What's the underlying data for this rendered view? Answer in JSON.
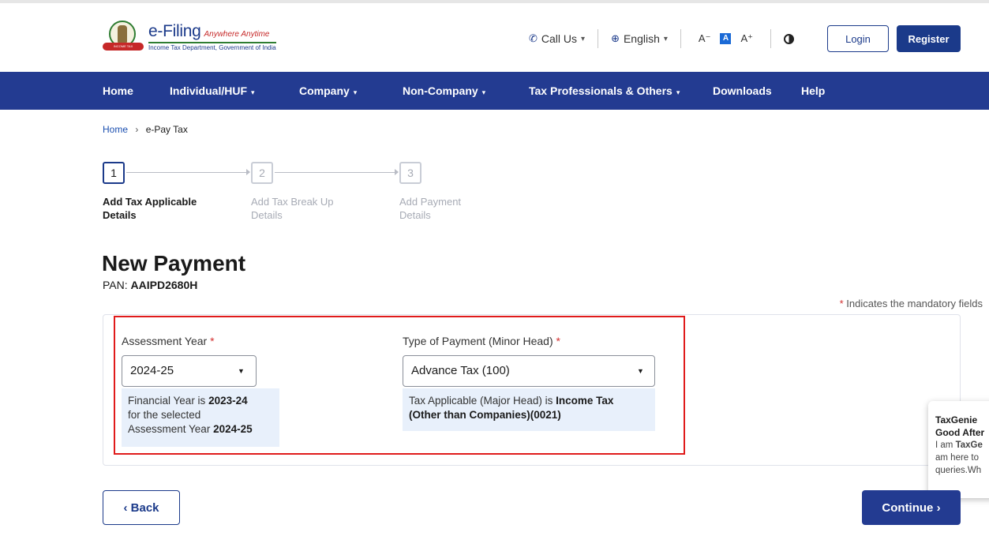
{
  "header": {
    "brand_name": "e-Filing",
    "brand_tagline": "Anywhere Anytime",
    "brand_subtitle": "Income Tax Department, Government of India",
    "emblem_ribbon_text": "INCOME TAX DEPARTMENT",
    "call_us": "Call Us",
    "language": "English",
    "font_decrease": "A⁻",
    "font_normal": "A",
    "font_increase": "A⁺",
    "login": "Login",
    "register": "Register",
    "accent_color": "#1b3a8a"
  },
  "nav": {
    "items": [
      {
        "label": "Home"
      },
      {
        "label": "Individual/HUF"
      },
      {
        "label": "Company"
      },
      {
        "label": "Non-Company"
      },
      {
        "label": "Tax Professionals & Others"
      },
      {
        "label": "Downloads"
      },
      {
        "label": "Help"
      }
    ],
    "background_color": "#233b91"
  },
  "breadcrumb": {
    "home": "Home",
    "current": "e-Pay Tax"
  },
  "stepper": {
    "steps": [
      {
        "number": "1",
        "line1": "Add Tax Applicable",
        "line2": "Details",
        "state": "active"
      },
      {
        "number": "2",
        "line1": "Add Tax Break Up",
        "line2": "Details",
        "state": "inactive"
      },
      {
        "number": "3",
        "line1": "Add Payment",
        "line2": "Details",
        "state": "inactive"
      }
    ]
  },
  "page": {
    "title": "New Payment",
    "pan_label": "PAN:",
    "pan_value": "AAIPD2680H",
    "mandatory_star": "*",
    "mandatory_note": "Indicates the mandatory fields"
  },
  "form": {
    "assessment_year": {
      "label": "Assessment Year",
      "required_mark": "*",
      "value": "2024-25",
      "hint_prefix": "Financial Year is",
      "financial_year": "2023-24",
      "hint_middle": "for the selected",
      "hint_ay_text": "Assessment Year",
      "hint_ay_value": "2024-25"
    },
    "payment_type": {
      "label": "Type of Payment (Minor Head)",
      "required_mark": "*",
      "value": "Advance Tax (100)",
      "hint_prefix": "Tax Applicable (Major Head) is",
      "hint_bold_1": "Income Tax",
      "hint_bold_2": "(Other than Companies)(0021)"
    },
    "highlight_color": "#e01b1b"
  },
  "chat": {
    "title": "TaxGenie",
    "greeting": "Good After",
    "line1_prefix": "I am",
    "line1_bold": "TaxGe",
    "line2": "am here to",
    "line3": "queries.Wh"
  },
  "actions": {
    "back": "Back",
    "continue": "Continue"
  }
}
